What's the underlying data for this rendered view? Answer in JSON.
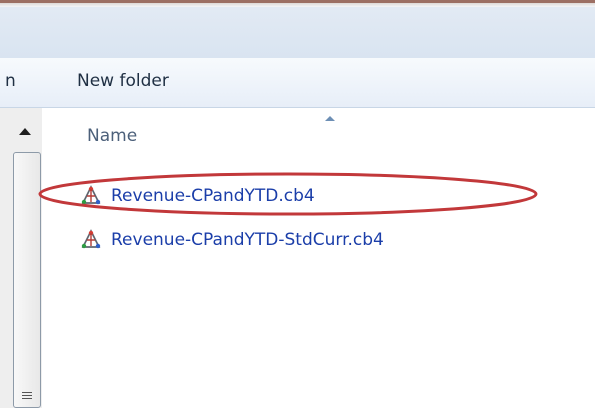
{
  "toolbar": {
    "left_fragment": "n",
    "new_folder_label": "New folder"
  },
  "file_list": {
    "column_header": "Name",
    "files": [
      {
        "name": "Revenue-CPandYTD.cb4",
        "icon": "cube-file-icon"
      },
      {
        "name": "Revenue-CPandYTD-StdCurr.cb4",
        "icon": "cube-file-icon"
      }
    ]
  },
  "annotation": {
    "color": "#c2383a"
  }
}
